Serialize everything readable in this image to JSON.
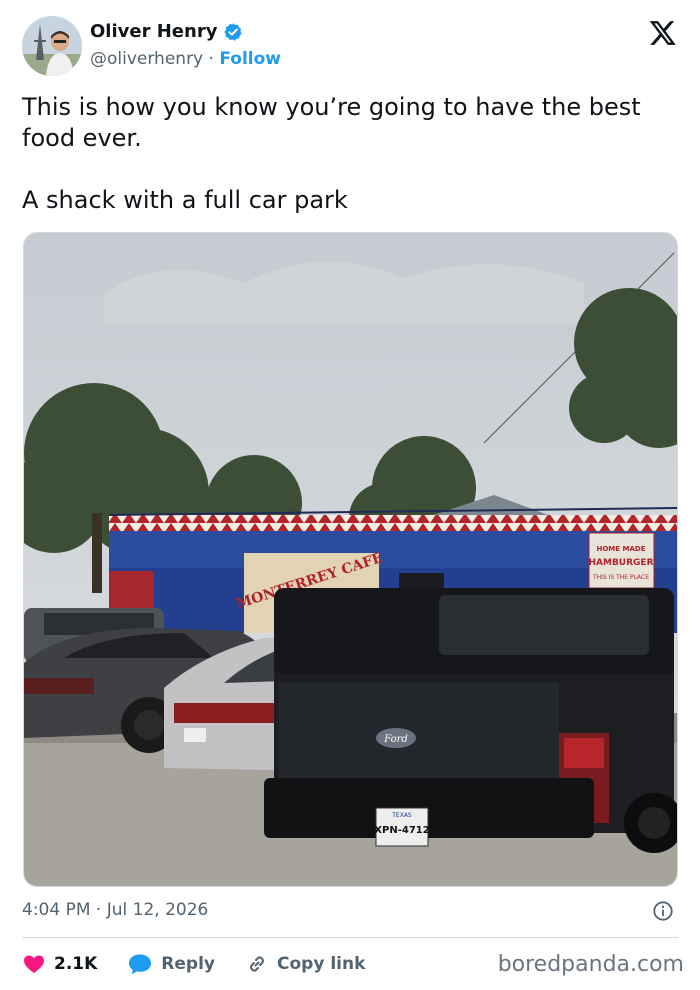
{
  "author": {
    "name": "Oliver Henry",
    "handle": "@oliverhenry",
    "separator": "·",
    "follow_label": "Follow",
    "verified": true,
    "avatar_icon": "person-in-front-of-eiffel-tower"
  },
  "tweet": {
    "lines": [
      "This is how you know you’re going to have the best food ever.",
      "A shack with a full car park"
    ]
  },
  "photo": {
    "sign_text": "MONTERREY CAFE",
    "side_sign_line1": "HOME MADE",
    "side_sign_line2": "HAMBURGER",
    "side_sign_line3": "THIS IS THE PLACE",
    "plate_state": "TEXAS",
    "plate_number": "XPN-4712",
    "truck_badge": "Ford"
  },
  "meta": {
    "timestamp": "4:04 PM · Jul 12, 2026"
  },
  "actions": {
    "like_count": "2.1K",
    "reply_label": "Reply",
    "copy_label": "Copy link"
  },
  "watermark": "boredpanda.com",
  "colors": {
    "accent": "#1d9bf0",
    "like": "#f91880",
    "text": "#0f1419",
    "muted": "#536471"
  }
}
